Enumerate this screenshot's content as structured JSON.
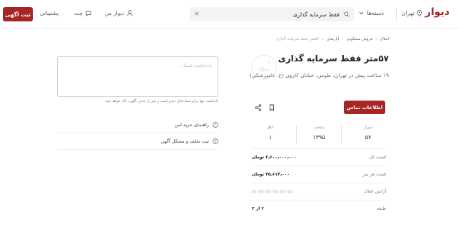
{
  "header": {
    "logo": "دیوار",
    "city": "تهران",
    "categories_label": "دسته‌ها",
    "search_value": "فقط سرمایه گذاری",
    "my_divar": "دیوار من",
    "chat": "چت",
    "support": "پشتیبانی",
    "post_button": "ثبت آگهی"
  },
  "breadcrumb": [
    "املاک",
    "فروش مسکونی",
    "آپارتمان",
    "۵۷متر فقط سرمایه گذاری"
  ],
  "ad": {
    "title": "۵۷متر فقط سرمایه گذاری",
    "subtitle": "۱۹ ساعت پیش در تهران، طوس، خیابان کارون (خ. دامپزشکی)",
    "contact_button": "اطلاعات تماس",
    "stats": [
      {
        "label": "متراژ",
        "value": "۵۷"
      },
      {
        "label": "ساخت",
        "value": "۱۳۹۵"
      },
      {
        "label": "اتاق",
        "value": "۱"
      }
    ],
    "rows": [
      {
        "label": "قیمت کل",
        "value": "۲٫۶۰۰٫۰۰۰٫۰۰۰ تومان"
      },
      {
        "label": "قیمت هر متر",
        "value": "۴۵٫۶۱۴٫۰۰۰ تومان"
      },
      {
        "label": "آژانس املاک",
        "value": ""
      },
      {
        "label": "طبقه",
        "value": "۲ از ۴"
      }
    ]
  },
  "note": {
    "placeholder": "یادداشت شما...",
    "hint": "یادداشت تنها برای شما قابل دیدن است و پس از حذف آگهی، پاک خواهد شد."
  },
  "links": [
    "راهنمای خرید امن",
    "ثبت تخلف و مشکل آگهی"
  ],
  "colors": {
    "brand": "#a62626"
  }
}
